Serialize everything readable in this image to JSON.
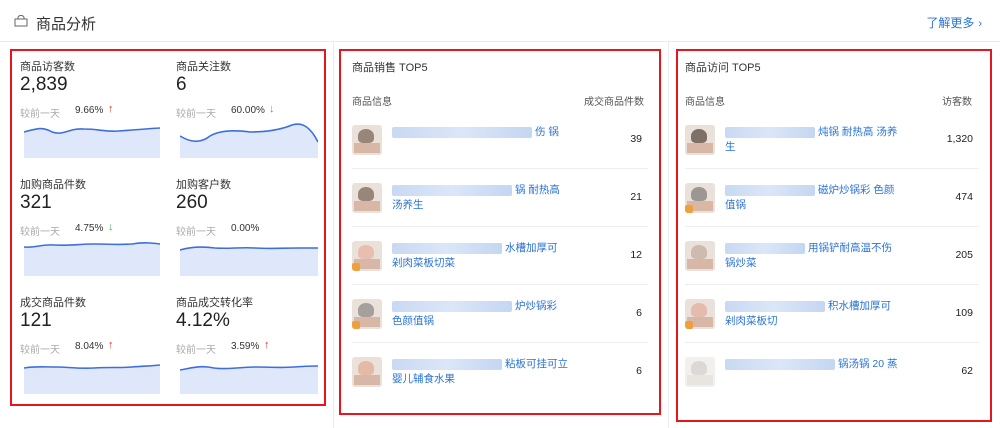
{
  "header": {
    "title": "商品分析",
    "more_label": "了解更多",
    "more_chevron": "›"
  },
  "metrics": [
    {
      "label": "商品访客数",
      "value": "2,839",
      "compare": "较前一天",
      "change": "9.66%",
      "dir": "up"
    },
    {
      "label": "商品关注数",
      "value": "6",
      "compare": "较前一天",
      "change": "60.00%",
      "dir": "down"
    },
    {
      "label": "加购商品件数",
      "value": "321",
      "compare": "较前一天",
      "change": "4.75%",
      "dir": "down"
    },
    {
      "label": "加购客户数",
      "value": "260",
      "compare": "较前一天",
      "change": "0.00%",
      "dir": "none"
    },
    {
      "label": "成交商品件数",
      "value": "121",
      "compare": "较前一天",
      "change": "8.04%",
      "dir": "up"
    },
    {
      "label": "商品成交转化率",
      "value": "4.12%",
      "compare": "较前一天",
      "change": "3.59%",
      "dir": "up"
    }
  ],
  "arrows": {
    "up": "↑",
    "down": "↓"
  },
  "colors": {
    "accent": "#2a72d6",
    "up": "#e0302f",
    "down": "#3bb55d",
    "highlight": "#e8141e",
    "spark_fill": "#dfe7fb",
    "spark_line": "#3d6fdc"
  },
  "sales_top5": {
    "title": "商品销售 TOP5",
    "col_info": "商品信息",
    "col_value": "成交商品件数",
    "rows": [
      {
        "desc": "伤 锅",
        "value": "39"
      },
      {
        "desc": "锅 耐热高 汤养生",
        "value": "21"
      },
      {
        "desc": "水槽加厚可 剁肉菜板切菜",
        "value": "12"
      },
      {
        "desc": "炉炒锅彩 色颜值锅",
        "value": "6"
      },
      {
        "desc": "粘板可挂可立 婴儿辅食水果",
        "value": "6"
      }
    ]
  },
  "visit_top5": {
    "title": "商品访问 TOP5",
    "col_info": "商品信息",
    "col_value": "访客数",
    "rows": [
      {
        "desc": "炖锅 耐热高 汤养生",
        "value": "1,320"
      },
      {
        "desc": "磁炉炒锅彩 色颜值锅",
        "value": "474"
      },
      {
        "desc": "用锅铲耐高温不伤 锅炒菜",
        "value": "205"
      },
      {
        "desc": "积水槽加厚可 剁肉菜板切",
        "value": "109"
      },
      {
        "desc": "锅汤锅 20 蒸",
        "value": "62"
      }
    ]
  }
}
